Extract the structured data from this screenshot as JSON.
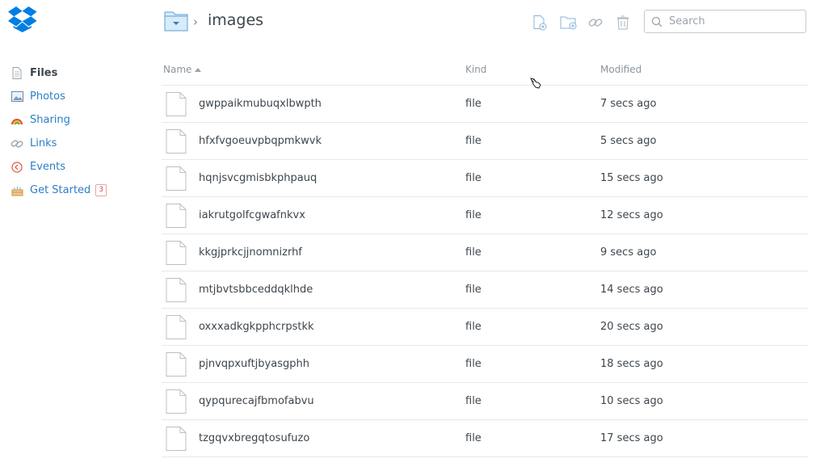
{
  "sidebar": {
    "items": [
      {
        "label": "Files",
        "icon": "file-icon",
        "active": true
      },
      {
        "label": "Photos",
        "icon": "photos-icon"
      },
      {
        "label": "Sharing",
        "icon": "sharing-icon"
      },
      {
        "label": "Links",
        "icon": "link-icon"
      },
      {
        "label": "Events",
        "icon": "events-icon"
      },
      {
        "label": "Get Started",
        "icon": "cake-icon",
        "badge": "3"
      }
    ]
  },
  "header": {
    "breadcrumb_title": "images",
    "search_placeholder": "Search"
  },
  "table": {
    "columns": {
      "name": "Name",
      "kind": "Kind",
      "modified": "Modified"
    },
    "rows": [
      {
        "name": "gwppaikmubuqxlbwpth",
        "kind": "file",
        "modified": "7 secs ago"
      },
      {
        "name": "hfxfvgoeuvpbqpmkwvk",
        "kind": "file",
        "modified": "5 secs ago"
      },
      {
        "name": "hqnjsvcgmisbkphpauq",
        "kind": "file",
        "modified": "15 secs ago"
      },
      {
        "name": "iakrutgolfcgwafnkvx",
        "kind": "file",
        "modified": "12 secs ago"
      },
      {
        "name": "kkgjprkcjjnomnizrhf",
        "kind": "file",
        "modified": "9 secs ago"
      },
      {
        "name": "mtjbvtsbbceddqklhde",
        "kind": "file",
        "modified": "14 secs ago"
      },
      {
        "name": "oxxxadkgkpphcrpstkk",
        "kind": "file",
        "modified": "20 secs ago"
      },
      {
        "name": "pjnvqpxuftjbyasgphh",
        "kind": "file",
        "modified": "18 secs ago"
      },
      {
        "name": "qypqurecajfbmofabvu",
        "kind": "file",
        "modified": "10 secs ago"
      },
      {
        "name": "tzgqvxbregqtosufuzo",
        "kind": "file",
        "modified": "17 secs ago"
      }
    ]
  },
  "colors": {
    "accent": "#2a7fc6",
    "text": "#3d464d",
    "muted": "#8a959e",
    "logo": "#007ee5"
  }
}
